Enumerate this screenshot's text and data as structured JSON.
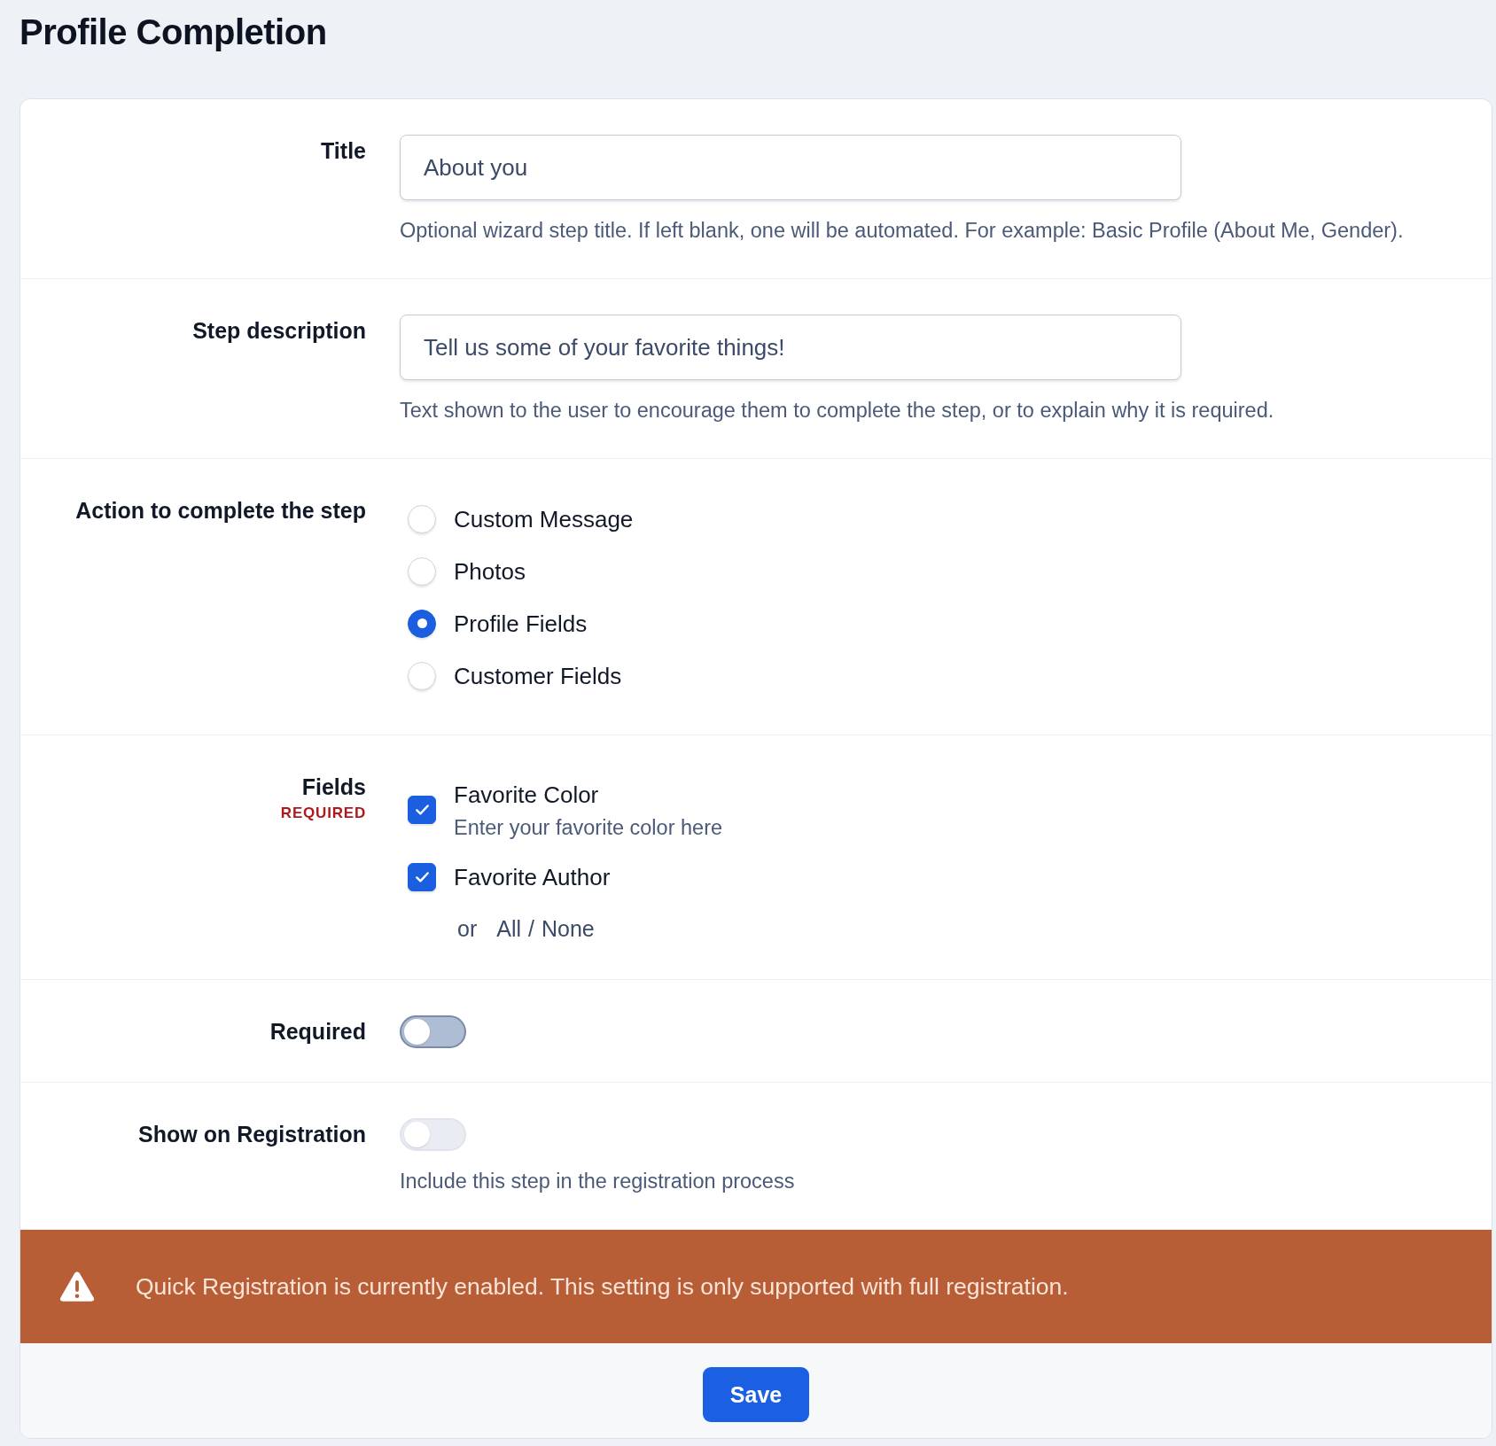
{
  "heading": "Profile Completion",
  "rows": [
    {
      "kind": "text",
      "label": "Title",
      "value": "About you",
      "help": "Optional wizard step title. If left blank, one will be automated. For example: Basic Profile (About Me, Gender)."
    },
    {
      "kind": "text",
      "label": "Step description",
      "value": "Tell us some of your favorite things!",
      "help": "Text shown to the user to encourage them to complete the step, or to explain why it is required."
    },
    {
      "kind": "radio",
      "label": "Action to complete the step",
      "options": [
        {
          "label": "Custom Message",
          "selected": false
        },
        {
          "label": "Photos",
          "selected": false
        },
        {
          "label": "Profile Fields",
          "selected": true
        },
        {
          "label": "Customer Fields",
          "selected": false
        }
      ]
    },
    {
      "kind": "checkbox",
      "label": "Fields",
      "required_tag": "REQUIRED",
      "options": [
        {
          "label": "Favorite Color",
          "description": "Enter your favorite color here",
          "checked": true
        },
        {
          "label": "Favorite Author",
          "checked": true
        }
      ],
      "select_links": {
        "prefix": "or",
        "all": "All",
        "separator": "/",
        "none": "None"
      }
    },
    {
      "kind": "toggle",
      "label": "Required",
      "on": false,
      "disabled": false
    },
    {
      "kind": "toggle",
      "label": "Show on Registration",
      "on": false,
      "disabled": true,
      "help": "Include this step in the registration process"
    }
  ],
  "alert": {
    "kind": "warning",
    "text": "Quick Registration is currently enabled. This setting is only supported with full registration."
  },
  "buttons": [
    "Save"
  ]
}
